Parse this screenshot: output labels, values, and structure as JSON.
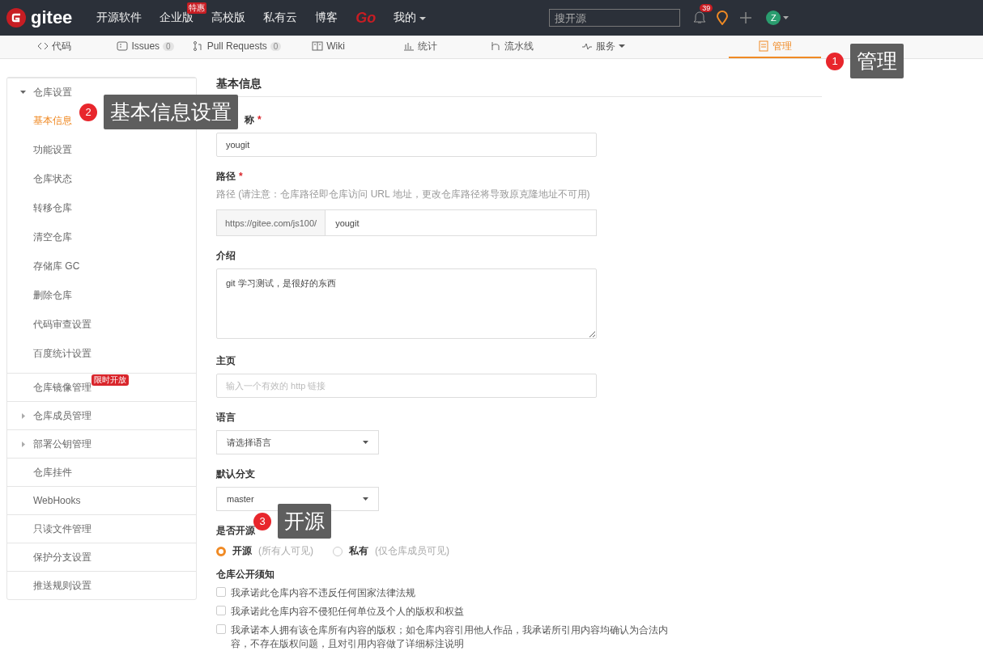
{
  "topnav": {
    "logo": "gitee",
    "items": [
      {
        "label": "开源软件"
      },
      {
        "label": "企业版",
        "badge": "特惠"
      },
      {
        "label": "高校版"
      },
      {
        "label": "私有云"
      },
      {
        "label": "博客"
      },
      {
        "label": "Go",
        "kind": "brand"
      },
      {
        "label": "我的",
        "kind": "dropdown"
      }
    ],
    "search": {
      "placeholder": "搜开源"
    },
    "notifications": "39",
    "avatar": "Z"
  },
  "tabs": [
    {
      "label": "代码",
      "selected": false
    },
    {
      "label": "Issues",
      "count": "0",
      "selected": false
    },
    {
      "label": "Pull Requests",
      "count": "0",
      "selected": false
    },
    {
      "label": "Wiki",
      "selected": false
    },
    {
      "label": "统计",
      "selected": false
    },
    {
      "label": "流水线",
      "selected": false
    },
    {
      "label": "服务",
      "dropdown": true,
      "selected": false
    },
    {
      "label": "管理",
      "selected": true
    }
  ],
  "sidebar": {
    "groups": [
      {
        "label": "仓库设置",
        "expanded": true,
        "children": [
          {
            "label": "基本信息",
            "selected": true
          },
          {
            "label": "功能设置",
            "selected": false
          },
          {
            "label": "仓库状态",
            "selected": false
          },
          {
            "label": "转移仓库",
            "selected": false
          },
          {
            "label": "清空仓库",
            "selected": false
          },
          {
            "label": "存储库 GC",
            "selected": false
          },
          {
            "label": "删除仓库",
            "selected": false
          },
          {
            "label": "代码审查设置",
            "selected": false
          },
          {
            "label": "百度统计设置",
            "selected": false
          }
        ]
      },
      {
        "label": "仓库镜像管理",
        "badge": "限时开放"
      },
      {
        "label": "仓库成员管理",
        "expanded": false
      },
      {
        "label": "部署公钥管理",
        "expanded": false
      },
      {
        "label": "仓库挂件"
      },
      {
        "label": "WebHooks"
      },
      {
        "label": "只读文件管理"
      },
      {
        "label": "保护分支设置"
      },
      {
        "label": "推送规则设置"
      }
    ]
  },
  "form": {
    "title": "基本信息",
    "name": {
      "label": "称",
      "required_mark": "*",
      "value": "yougit"
    },
    "path": {
      "label": "路径",
      "required_mark": "*",
      "hint": "路径 (请注意：仓库路径即仓库访问 URL 地址，更改仓库路径将导致原克隆地址不可用)",
      "prefix": "https://gitee.com/js100/",
      "value": "yougit"
    },
    "intro": {
      "label": "介绍",
      "value": "git 学习测试，是很好的东西"
    },
    "homepage": {
      "label": "主页",
      "placeholder": "输入一个有效的 http 链接"
    },
    "language": {
      "label": "语言",
      "value": "请选择语言"
    },
    "branch": {
      "label": "默认分支",
      "value": "master"
    },
    "visibility": {
      "label": "是否开源",
      "options": [
        {
          "label": "开源",
          "note": "(所有人可见)",
          "selected": true
        },
        {
          "label": "私有",
          "note": "(仅仓库成员可见)",
          "selected": false
        }
      ]
    },
    "notice": {
      "label": "仓库公开须知",
      "items": [
        {
          "text": "我承诺此仓库内容不违反任何国家法律法规",
          "checked": false
        },
        {
          "text": "我承诺此仓库内容不侵犯任何单位及个人的版权和权益",
          "checked": false
        },
        {
          "text": "我承诺本人拥有该仓库所有内容的版权；如仓库内容引用他人作品，我承诺所引用内容均确认为合法内容，不存在版权问题，且对引用内容做了详细标注说明",
          "checked": false
        }
      ]
    }
  },
  "callouts": [
    {
      "number": "1",
      "text": "管理"
    },
    {
      "number": "2",
      "text": "基本信息设置"
    },
    {
      "number": "3",
      "text": "开源"
    }
  ]
}
